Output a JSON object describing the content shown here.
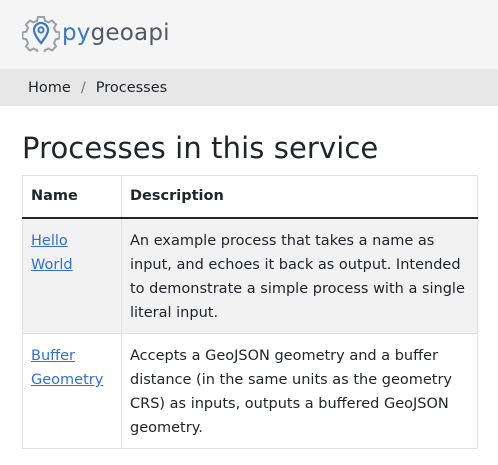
{
  "app": {
    "logo_prefix": "py",
    "logo_suffix": "geoapi"
  },
  "breadcrumb": {
    "items": [
      "Home",
      "Processes"
    ],
    "separator": "/"
  },
  "page": {
    "title": "Processes in this service"
  },
  "table": {
    "headers": [
      "Name",
      "Description"
    ],
    "rows": [
      {
        "name": "Hello World",
        "description": "An example process that takes a name as input, and echoes it back as output. Intended to demonstrate a simple process with a single literal input."
      },
      {
        "name": "Buffer Geometry",
        "description": "Accepts a GeoJSON geometry and a buffer distance (in the same units as the geometry CRS) as inputs, outputs a buffered GeoJSON geometry."
      }
    ]
  },
  "colors": {
    "link": "#2f6fd6",
    "logo_blue": "#3b78c2",
    "logo_grey": "#53595f",
    "header_bg": "#f5f5f5",
    "breadcrumb_bg": "#e7e7e7",
    "stripe_bg": "#f2f2f2"
  },
  "icons": {
    "logo": "gear-map-pin-icon"
  }
}
